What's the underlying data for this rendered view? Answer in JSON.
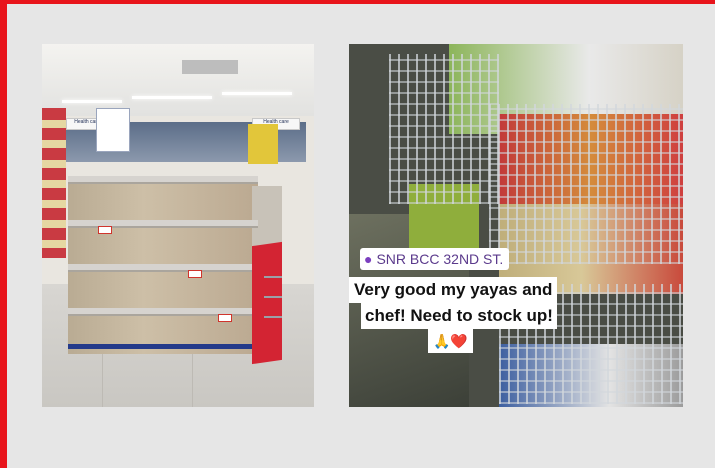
{
  "left_photo": {
    "signs": [
      "Health care",
      "Health care"
    ]
  },
  "right_photo": {
    "location_sticker": "SNR BCC 32ND ST.",
    "caption_line1": "Very good my yayas and",
    "caption_line2": "chef! Need to stock up!",
    "caption_emoji": "🙏❤️"
  },
  "icons": {
    "location": "location-pin-icon"
  },
  "colors": {
    "frame_accent": "#e8141b",
    "background": "#e6e6e6",
    "location_text": "#5b3a8c"
  }
}
